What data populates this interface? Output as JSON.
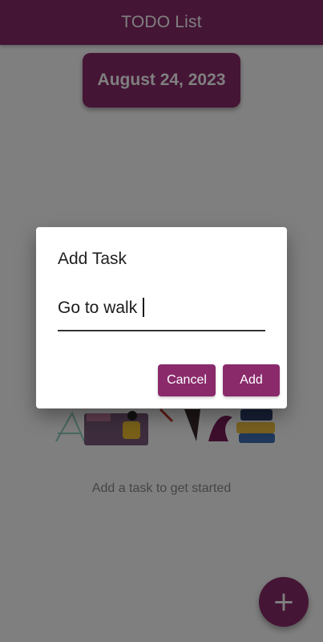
{
  "appbar": {
    "title": "TODO List"
  },
  "date_chip": {
    "label": "August 24, 2023"
  },
  "empty_state": {
    "message": "Add a task to get started"
  },
  "fab": {
    "icon": "plus-icon",
    "symbol": "+"
  },
  "dialog": {
    "title": "Add Task",
    "input_value": "Go to walk",
    "cancel_label": "Cancel",
    "add_label": "Add"
  },
  "colors": {
    "primary": "#8a2a6b",
    "scrim": "rgba(0,0,0,0.5)",
    "background": "#ffffff"
  }
}
